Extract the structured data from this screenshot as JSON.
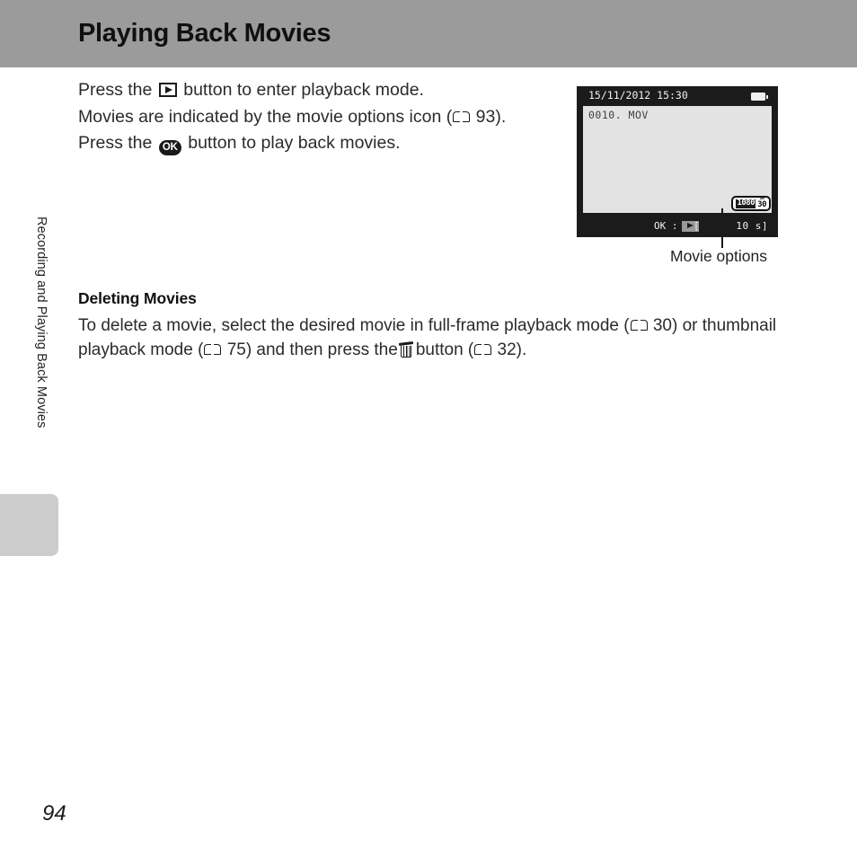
{
  "header": {
    "title": "Playing Back Movies",
    "band_color": "#9b9b9b"
  },
  "sidebar": {
    "chapter_label": "Recording and Playing Back Movies",
    "tab_color": "#cccccc"
  },
  "body": {
    "lines": [
      {
        "pre": "Press the",
        "icon": "playback-button-icon",
        "post": "button to enter playback mode."
      },
      {
        "pre": "Movies are indicated by the movie options icon (",
        "icon": "book-reference-icon",
        "post": "93)."
      },
      {
        "pre": "Press the",
        "icon": "ok-button-icon",
        "post": "button to play back movies."
      }
    ],
    "line1_pre": "Press the",
    "line1_post": "button to enter playback mode.",
    "line2_pre": "Movies are indicated by the movie options icon (",
    "line2_ref": "93).",
    "line3_pre": "Press the",
    "line3_post": "button to play back movies.",
    "ok_label": "OK"
  },
  "subsection": {
    "heading": "Deleting Movies",
    "text_part1": "To delete a movie, select the desired movie in full-frame playback mode (",
    "ref1": "30) or thumbnail",
    "text_part2": "playback mode (",
    "ref2": "75) and then press the",
    "text_part3": "button (",
    "ref3": "32)."
  },
  "camera_screen": {
    "date": "15/11/2012  15:30",
    "filename": "0010. MOV",
    "battery_icon": "battery-full-icon",
    "ok_hint_label": "OK :",
    "play_icon": "play-icon",
    "bracket_left": "[",
    "duration": "10 s]",
    "movie_options_badge": {
      "resolution": "1080",
      "fps_sup": "30",
      "fps_num": "30"
    },
    "screen_bg": "#1b1b1b",
    "image_bg": "#e3e3e3"
  },
  "callout": {
    "label": "Movie options"
  },
  "folio": {
    "page_number": "94"
  }
}
